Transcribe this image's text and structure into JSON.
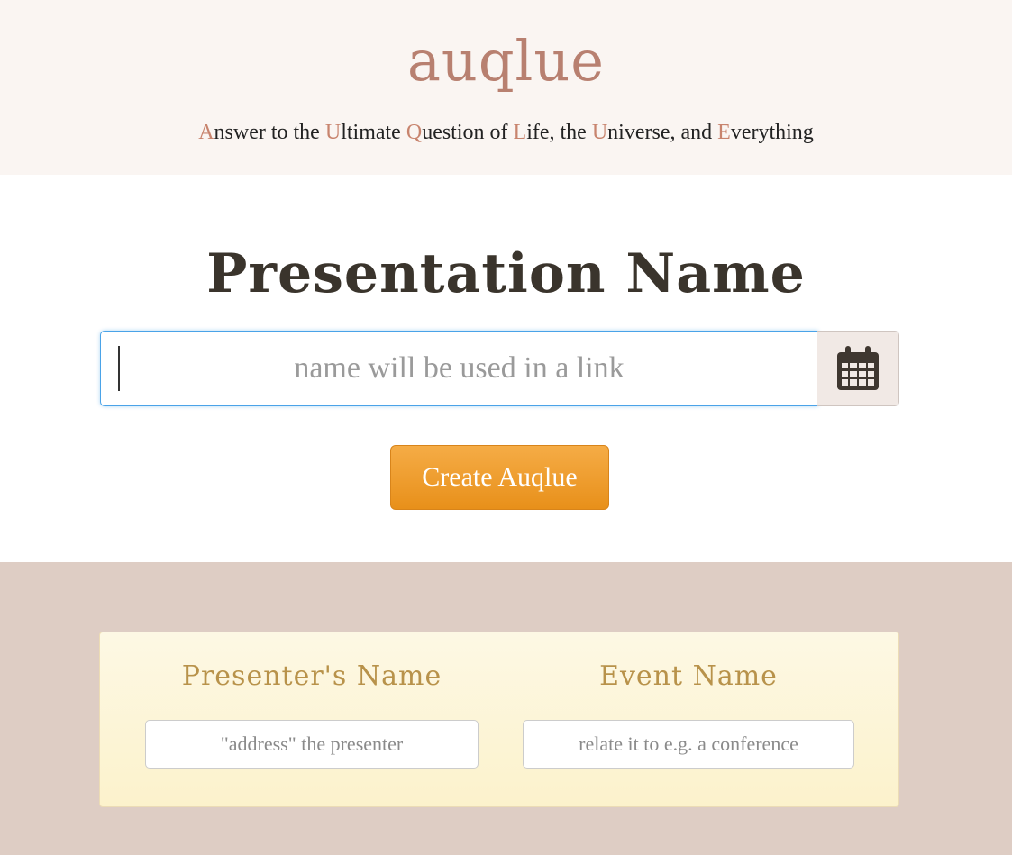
{
  "header": {
    "logo": "auqlue",
    "tagline": [
      {
        "text": "A",
        "hl": true
      },
      {
        "text": "nswer to the ",
        "hl": false
      },
      {
        "text": "U",
        "hl": true
      },
      {
        "text": "ltimate ",
        "hl": false
      },
      {
        "text": "Q",
        "hl": true
      },
      {
        "text": "uestion of ",
        "hl": false
      },
      {
        "text": "L",
        "hl": true
      },
      {
        "text": "ife, the ",
        "hl": false
      },
      {
        "text": "U",
        "hl": true
      },
      {
        "text": "niverse, and ",
        "hl": false
      },
      {
        "text": "E",
        "hl": true
      },
      {
        "text": "verything",
        "hl": false
      }
    ]
  },
  "main": {
    "title": "Presentation Name",
    "name_input": {
      "value": "",
      "placeholder": "name will be used in a link"
    },
    "calendar_icon": "calendar-icon",
    "create_button": "Create Auqlue"
  },
  "details": {
    "presenter_label": "Presenter's Name",
    "presenter_placeholder": "\"address\" the presenter",
    "event_label": "Event Name",
    "event_placeholder": "relate it to e.g. a conference"
  },
  "colors": {
    "header_bg": "#faf5f2",
    "logo": "#b88070",
    "accent_letters": "#c8846e",
    "button": "#ee9a2a",
    "lower_bg": "#decdc4",
    "panel_bg": "#fcf4d6",
    "field_label": "#b8924a",
    "focus_border": "#4aa3e8"
  }
}
